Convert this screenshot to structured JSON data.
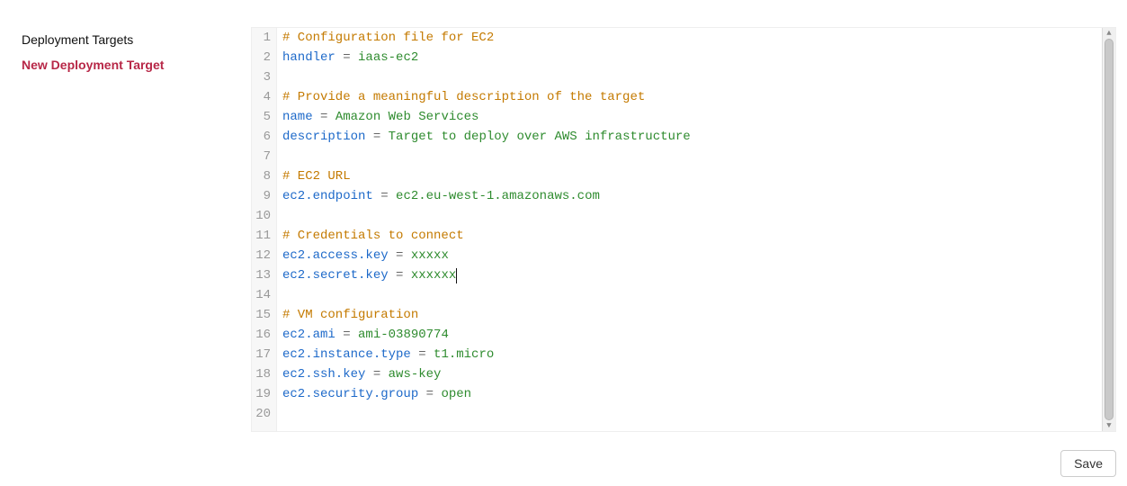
{
  "sidebar": {
    "items": [
      {
        "label": "Deployment Targets",
        "active": false
      },
      {
        "label": "New Deployment Target",
        "active": true
      }
    ]
  },
  "editor": {
    "lines": [
      {
        "n": 1,
        "type": "comment",
        "text": "# Configuration file for EC2"
      },
      {
        "n": 2,
        "type": "kv",
        "key": "handler",
        "value": "iaas-ec2"
      },
      {
        "n": 3,
        "type": "blank"
      },
      {
        "n": 4,
        "type": "comment",
        "text": "# Provide a meaningful description of the target"
      },
      {
        "n": 5,
        "type": "kv",
        "key": "name",
        "value": "Amazon Web Services"
      },
      {
        "n": 6,
        "type": "kv",
        "key": "description",
        "value": "Target to deploy over AWS infrastructure"
      },
      {
        "n": 7,
        "type": "blank"
      },
      {
        "n": 8,
        "type": "comment",
        "text": "# EC2 URL"
      },
      {
        "n": 9,
        "type": "kv",
        "key": "ec2.endpoint",
        "value": "ec2.eu-west-1.amazonaws.com"
      },
      {
        "n": 10,
        "type": "blank"
      },
      {
        "n": 11,
        "type": "comment",
        "text": "# Credentials to connect"
      },
      {
        "n": 12,
        "type": "kv",
        "key": "ec2.access.key",
        "value": "xxxxx"
      },
      {
        "n": 13,
        "type": "kv",
        "key": "ec2.secret.key",
        "value": "xxxxxx",
        "cursor": true
      },
      {
        "n": 14,
        "type": "blank"
      },
      {
        "n": 15,
        "type": "comment",
        "text": "# VM configuration"
      },
      {
        "n": 16,
        "type": "kv",
        "key": "ec2.ami",
        "value": "ami-03890774"
      },
      {
        "n": 17,
        "type": "kv",
        "key": "ec2.instance.type",
        "value": "t1.micro"
      },
      {
        "n": 18,
        "type": "kv",
        "key": "ec2.ssh.key",
        "value": "aws-key"
      },
      {
        "n": 19,
        "type": "kv",
        "key": "ec2.security.group",
        "value": "open"
      },
      {
        "n": 20,
        "type": "blank"
      }
    ]
  },
  "buttons": {
    "save": "Save"
  }
}
